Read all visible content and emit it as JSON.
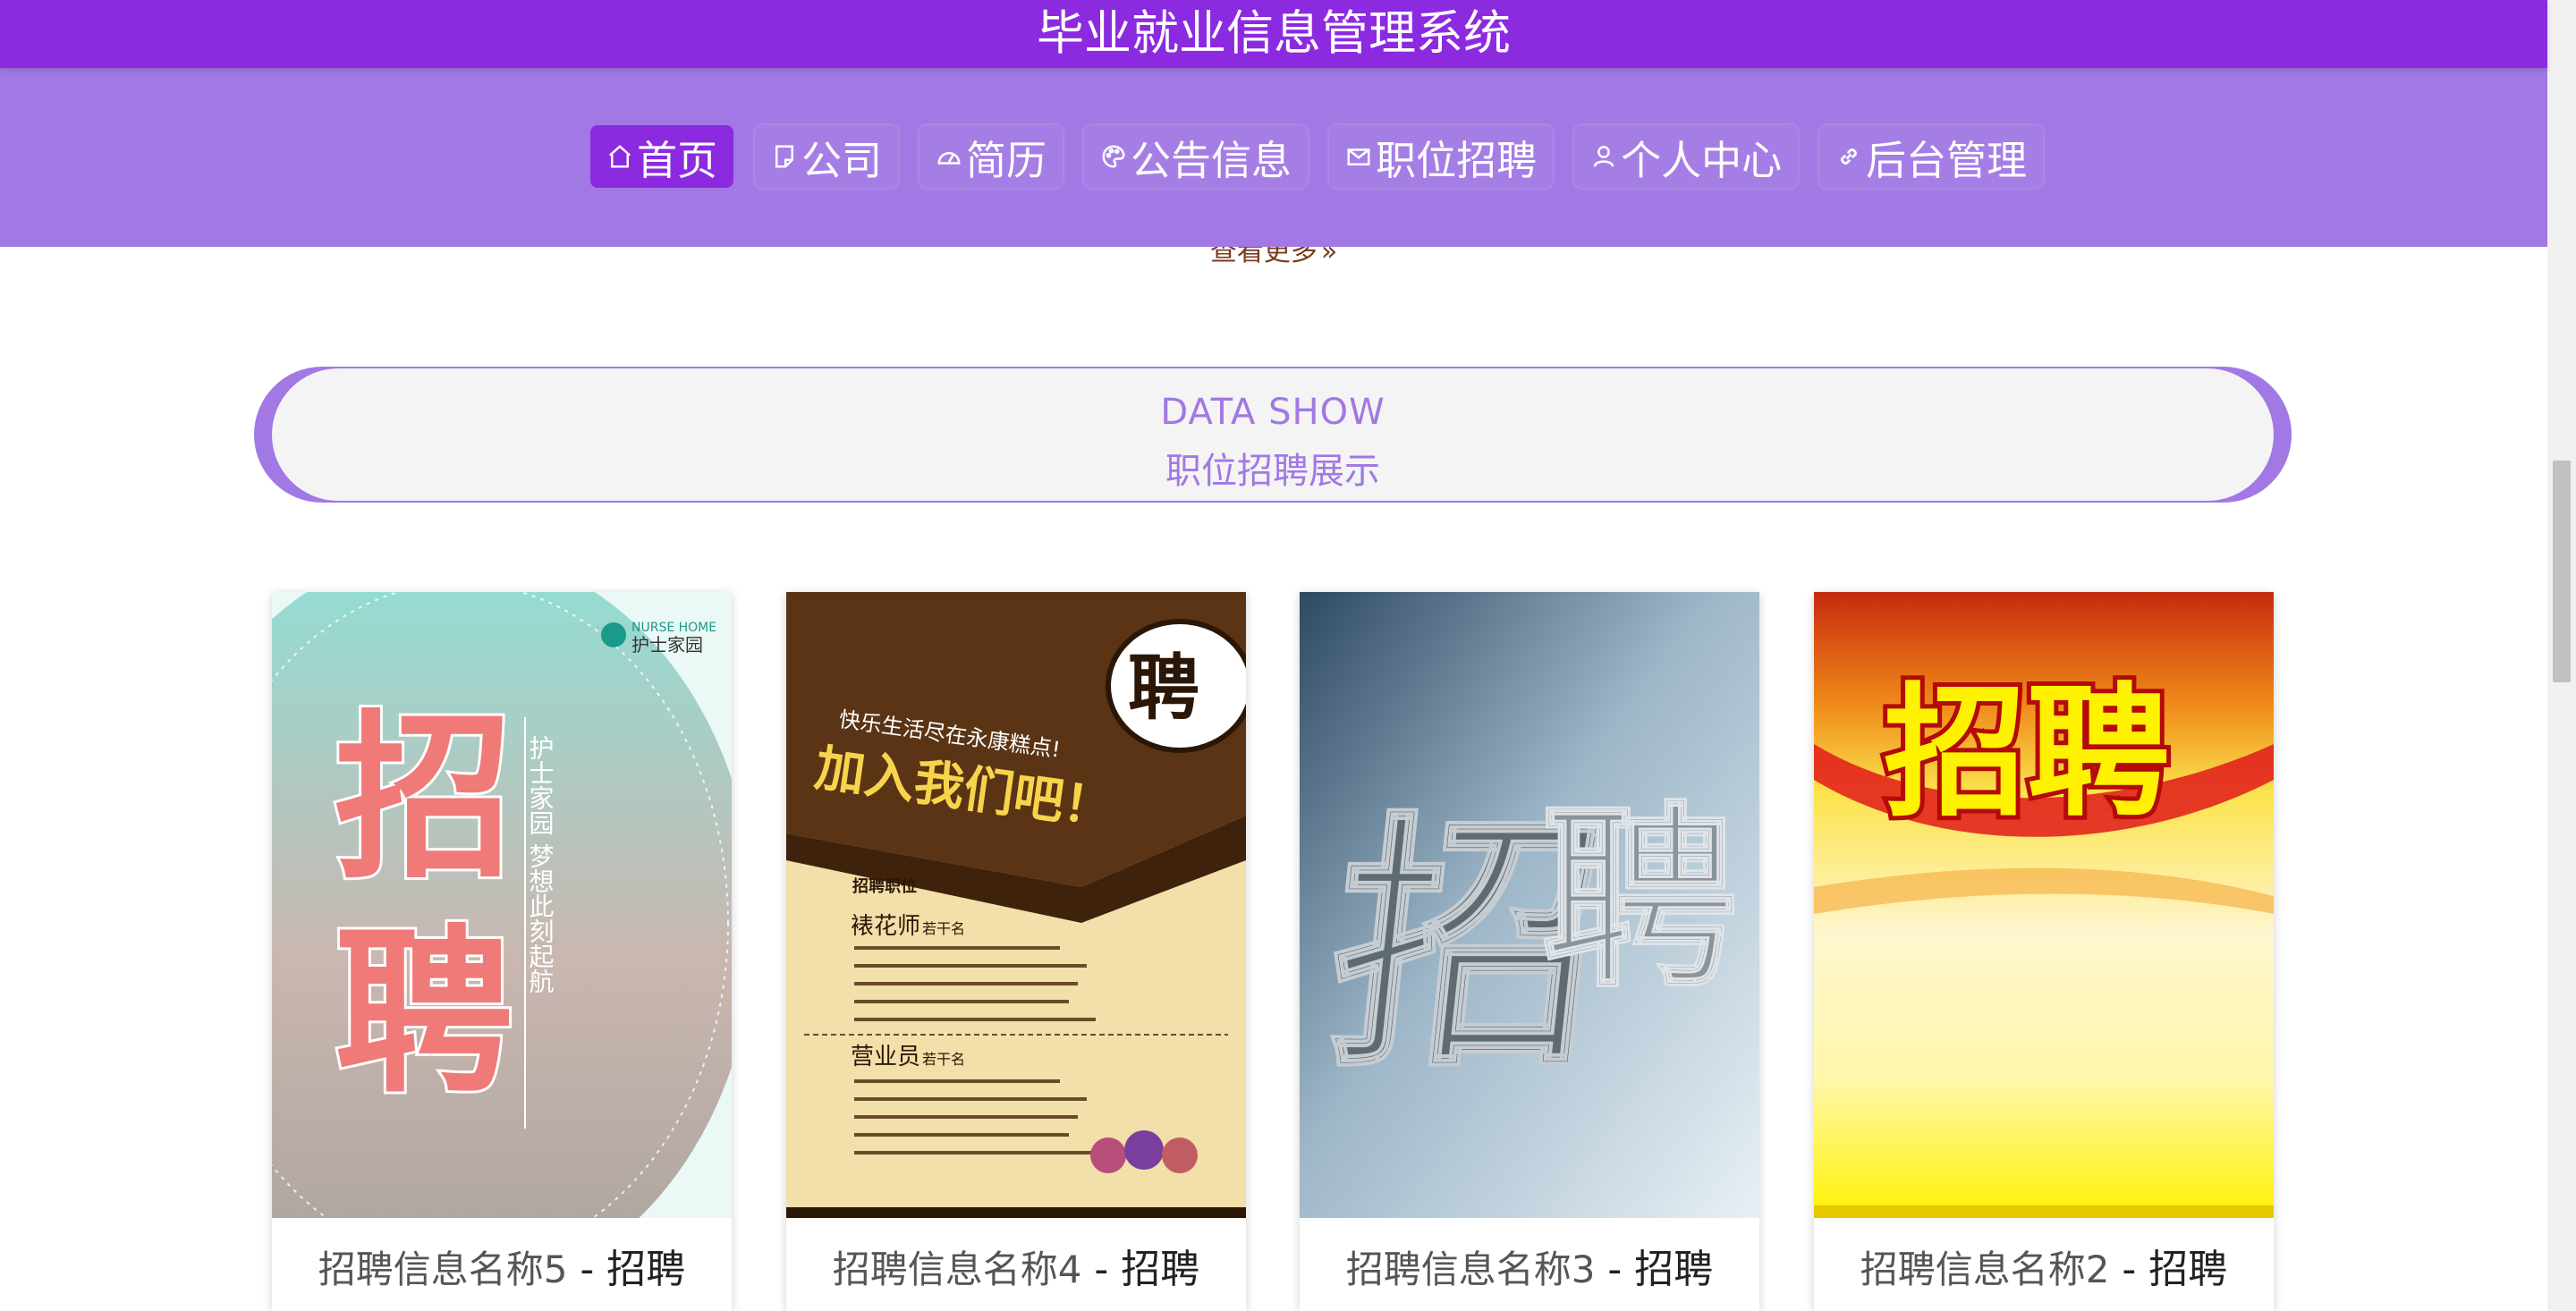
{
  "header": {
    "title": "毕业就业信息管理系统"
  },
  "nav": {
    "items": [
      {
        "label": "首页",
        "icon": "home-icon",
        "active": true
      },
      {
        "label": "公司",
        "icon": "document-icon",
        "active": false
      },
      {
        "label": "简历",
        "icon": "gauge-icon",
        "active": false
      },
      {
        "label": "公告信息",
        "icon": "palette-icon",
        "active": false
      },
      {
        "label": "职位招聘",
        "icon": "mail-icon",
        "active": false
      },
      {
        "label": "个人中心",
        "icon": "user-icon",
        "active": false
      },
      {
        "label": "后台管理",
        "icon": "link-icon",
        "active": false
      }
    ]
  },
  "more_link": {
    "label": "查看更多",
    "icon": "double-chevron-right-icon"
  },
  "section": {
    "title_en": "DATA SHOW",
    "title_cn": "职位招聘展示"
  },
  "cards": [
    {
      "name": "招聘信息名称5",
      "separator": " - ",
      "job": "招聘",
      "poster": {
        "brand": "NURSE HOME",
        "brand_cn": "护士家园",
        "big_char_1": "招",
        "big_char_2": "聘",
        "slogan": "护士家园 梦想此刻起航"
      }
    },
    {
      "name": "招聘信息名称4",
      "separator": " - ",
      "job": "招聘",
      "poster": {
        "badge": "聘",
        "line_1": "快乐生活尽在永康糕点!",
        "line_2": "加入我们吧！",
        "section_label": "招聘职位",
        "role_1": "裱花师",
        "role_1_count": "若干名",
        "role_2": "营业员",
        "role_2_count": "若干名"
      }
    },
    {
      "name": "招聘信息名称3",
      "separator": " - ",
      "job": "招聘",
      "poster": {
        "big_char_1": "招",
        "big_char_2": "聘"
      }
    },
    {
      "name": "招聘信息名称2",
      "separator": " - ",
      "job": "招聘",
      "poster": {
        "big_text": "招聘"
      }
    }
  ],
  "colors": {
    "primary": "#8c2ae0",
    "nav_background": "#a178e4",
    "accent_text": "#a178e4",
    "more_link": "#7a3c1f"
  }
}
